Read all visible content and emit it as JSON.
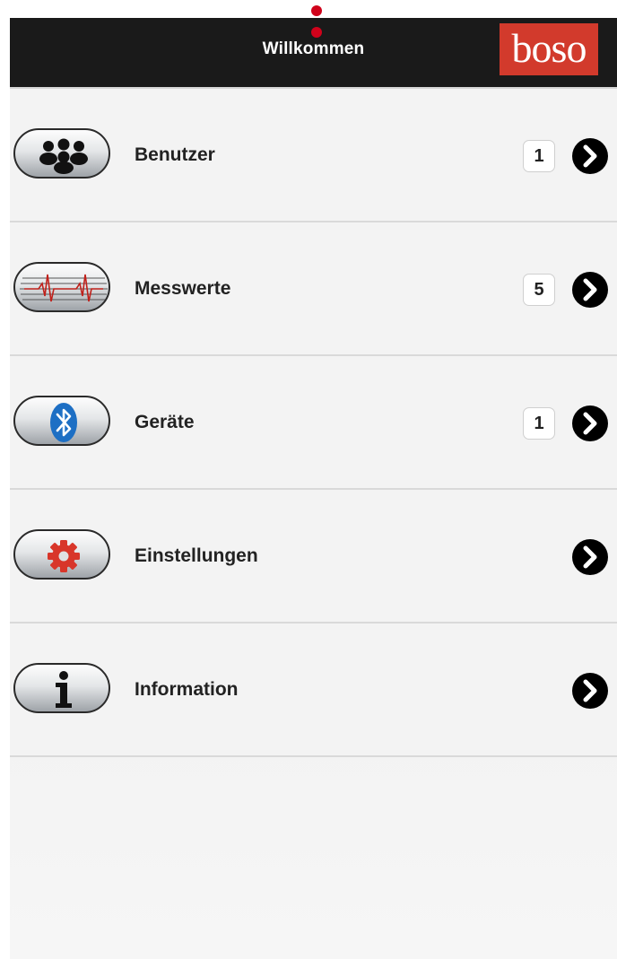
{
  "navbar": {
    "title": "Willkommen",
    "logo_text": "boso",
    "logo_color": "#d23a2c",
    "background": "#1a1a1a"
  },
  "accent_color": "#d0021b",
  "menu": {
    "items": [
      {
        "label": "Benutzer",
        "icon": "users-icon",
        "count": "1"
      },
      {
        "label": "Messwerte",
        "icon": "ecg-chart-icon",
        "count": "5"
      },
      {
        "label": "Geräte",
        "icon": "bluetooth-icon",
        "count": "1"
      },
      {
        "label": "Einstellungen",
        "icon": "gear-icon",
        "count": ""
      },
      {
        "label": "Information",
        "icon": "info-icon",
        "count": ""
      }
    ]
  }
}
